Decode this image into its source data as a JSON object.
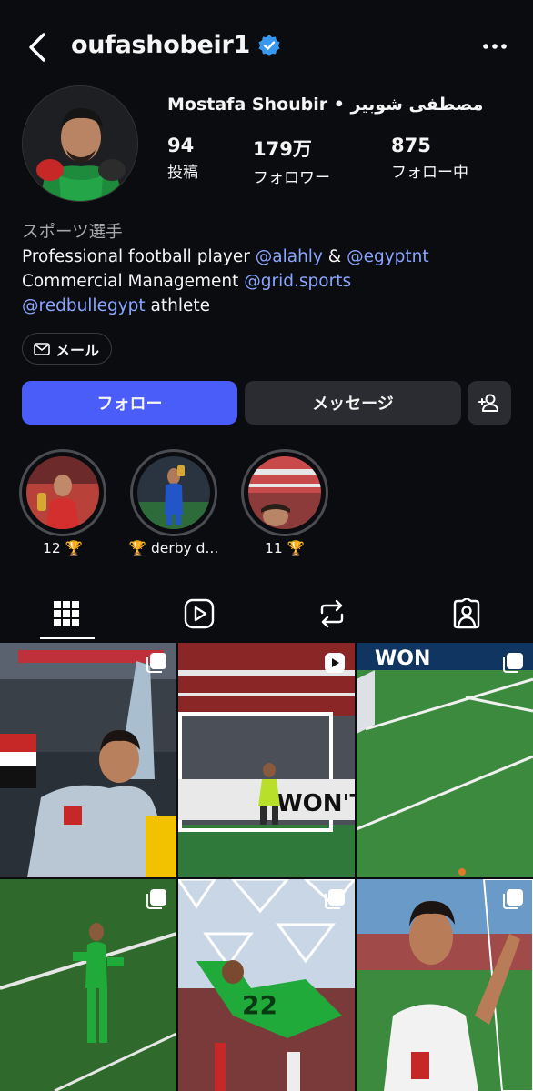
{
  "header": {
    "username": "oufashobeir1",
    "verified": true,
    "back_icon": "chevron-left-icon",
    "more_icon": "ellipsis-icon"
  },
  "profile": {
    "full_name": "Mostafa Shoubir • مصطفى شوبير",
    "stats": [
      {
        "value": "94",
        "label": "投稿"
      },
      {
        "value": "179万",
        "label": "フォロワー"
      },
      {
        "value": "875",
        "label": "フォロー中"
      }
    ],
    "category": "スポーツ選手",
    "bio": {
      "line1_prefix": "Professional football player ",
      "line1_mention1": "@alahly",
      "line1_amp": " & ",
      "line1_mention2": "@egyptnt",
      "line2_prefix": "Commercial Management ",
      "line2_mention": "@grid.sports",
      "line3_mention": "@redbullegypt",
      "line3_suffix": " athlete"
    },
    "mail_label": "メール"
  },
  "actions": {
    "follow_label": "フォロー",
    "message_label": "メッセージ",
    "add_user_icon": "person-add-icon"
  },
  "highlights": [
    {
      "label": "12 🏆"
    },
    {
      "label": "🏆 derby d..."
    },
    {
      "label": "11 🏆"
    }
  ],
  "tabs": [
    {
      "icon": "grid-icon",
      "active": true
    },
    {
      "icon": "reels-icon",
      "active": false
    },
    {
      "icon": "repost-icon",
      "active": false
    },
    {
      "icon": "tagged-icon",
      "active": false
    }
  ],
  "posts": [
    {
      "type": "carousel"
    },
    {
      "type": "reel",
      "text": "WON'T EV"
    },
    {
      "type": "carousel",
      "text": "WON"
    },
    {
      "type": "carousel"
    },
    {
      "type": "carousel"
    },
    {
      "type": "carousel"
    }
  ],
  "colors": {
    "background": "#0b0c10",
    "accent": "#4a5df9",
    "link": "#8aa5ff",
    "verified": "#3897f0",
    "button_secondary": "#2b2c31"
  }
}
